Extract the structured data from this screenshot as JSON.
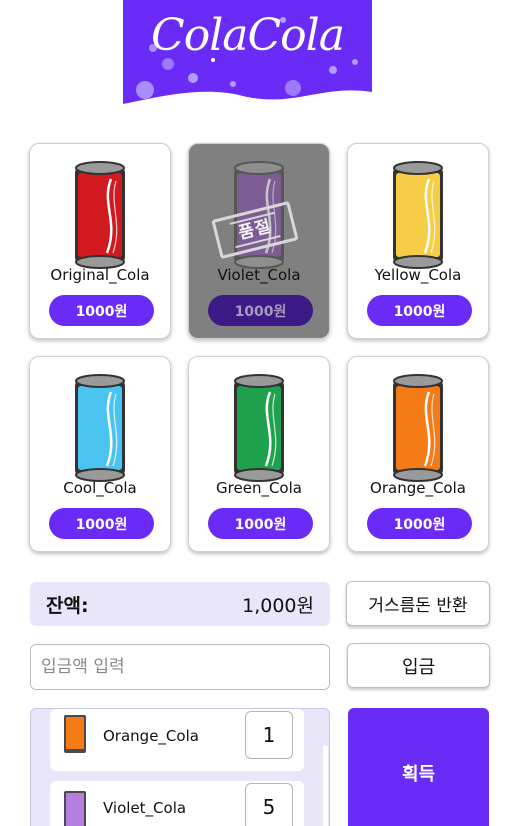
{
  "brand": {
    "logo_text": "ColaCola",
    "logo_color": "#6a2bf6"
  },
  "products": [
    {
      "name": "Original_Cola",
      "price": "1000원",
      "color": "#d01a1f",
      "sold_out": false
    },
    {
      "name": "Violet_Cola",
      "price": "1000원",
      "color": "#7b3fa5",
      "sold_out": true,
      "sold_out_label": "품절"
    },
    {
      "name": "Yellow_Cola",
      "price": "1000원",
      "color": "#f6cd47",
      "sold_out": false
    },
    {
      "name": "Cool_Cola",
      "price": "1000원",
      "color": "#4ac3f0",
      "sold_out": false
    },
    {
      "name": "Green_Cola",
      "price": "1000원",
      "color": "#1fa24d",
      "sold_out": false
    },
    {
      "name": "Orange_Cola",
      "price": "1000원",
      "color": "#f47b16",
      "sold_out": false
    }
  ],
  "wallet": {
    "balance_label": "잔액:",
    "balance_value": "1,000원",
    "change_button": "거스름돈 반환",
    "deposit_placeholder": "입금액 입력",
    "deposit_button": "입금"
  },
  "cart": {
    "items": [
      {
        "name": "Orange_Cola",
        "quantity": "1",
        "color": "#f47b16"
      },
      {
        "name": "Violet_Cola",
        "quantity": "5",
        "color": "#b57ee0"
      }
    ],
    "get_button": "획득"
  },
  "accent_color": "#6a2bf6"
}
